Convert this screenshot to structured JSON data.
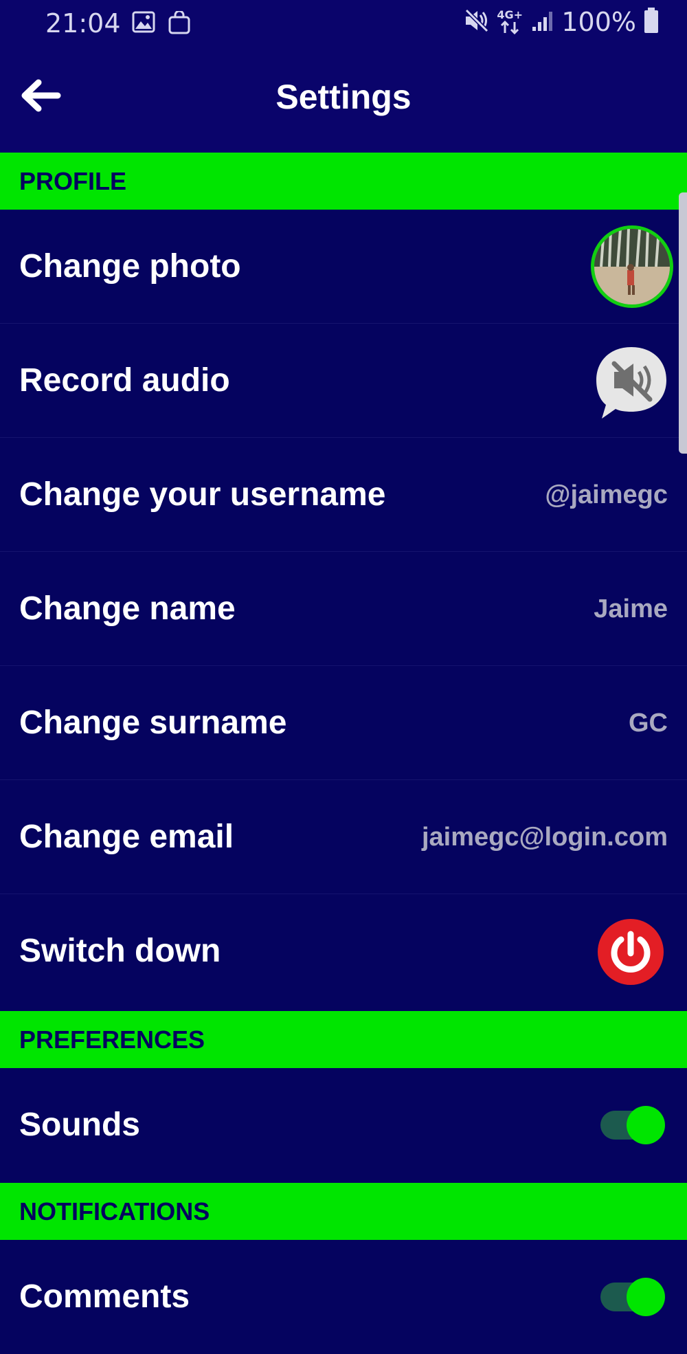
{
  "status_bar": {
    "time": "21:04",
    "battery": "100%",
    "network": "4G+",
    "icons": [
      "image-icon",
      "bag-icon",
      "mute-icon",
      "network-icon",
      "signal-icon",
      "battery-icon"
    ]
  },
  "header": {
    "title": "Settings",
    "back_icon": "back-arrow-icon"
  },
  "sections": {
    "profile": "PROFILE",
    "preferences": "PREFERENCES",
    "notifications": "NOTIFICATIONS"
  },
  "profile_rows": {
    "change_photo": {
      "label": "Change photo"
    },
    "record_audio": {
      "label": "Record audio"
    },
    "username": {
      "label": "Change your username",
      "value": "@jaimegc"
    },
    "name": {
      "label": "Change name",
      "value": "Jaime"
    },
    "surname": {
      "label": "Change surname",
      "value": "GC"
    },
    "email": {
      "label": "Change email",
      "value": "jaimegc@login.com"
    },
    "switch_down": {
      "label": "Switch down"
    }
  },
  "preferences_rows": {
    "sounds": {
      "label": "Sounds",
      "enabled": true
    }
  },
  "notifications_rows": {
    "comments": {
      "label": "Comments",
      "enabled": true
    }
  },
  "colors": {
    "background": "#05035f",
    "header": "#0a046b",
    "accent_green": "#00e500",
    "power_red": "#e31e25",
    "value_grey": "#a9a9c0"
  }
}
